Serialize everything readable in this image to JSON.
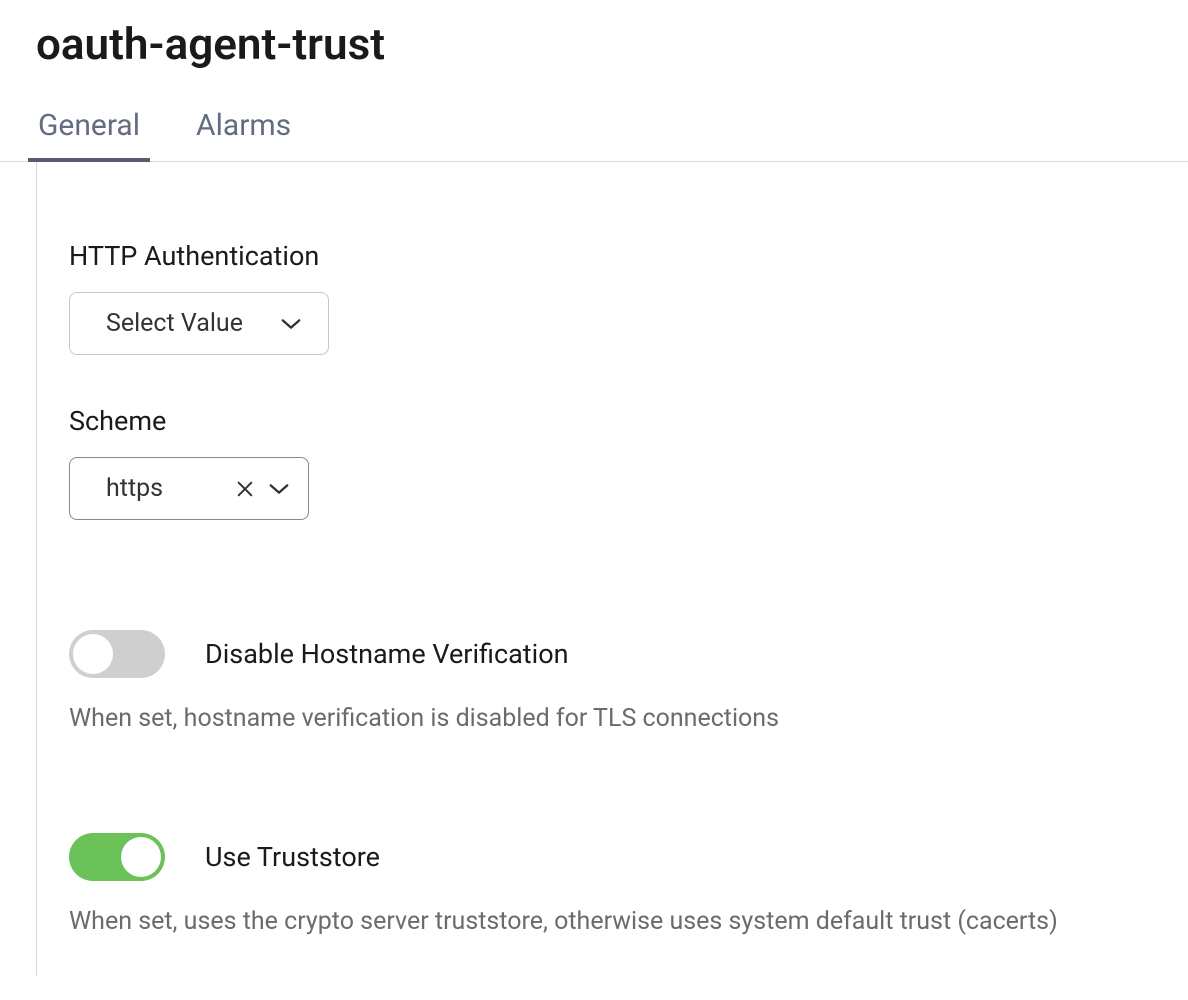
{
  "page": {
    "title": "oauth-agent-trust"
  },
  "tabs": [
    {
      "label": "General",
      "active": true
    },
    {
      "label": "Alarms",
      "active": false
    }
  ],
  "fields": {
    "httpAuthentication": {
      "label": "HTTP Authentication",
      "placeholder": "Select Value"
    },
    "scheme": {
      "label": "Scheme",
      "value": "https"
    }
  },
  "toggles": {
    "disableHostnameVerification": {
      "label": "Disable Hostname Verification",
      "description": "When set, hostname verification is disabled for TLS connections",
      "value": false
    },
    "useTruststore": {
      "label": "Use Truststore",
      "description": "When set, uses the crypto server truststore, otherwise uses system default trust (cacerts)",
      "value": true
    }
  }
}
